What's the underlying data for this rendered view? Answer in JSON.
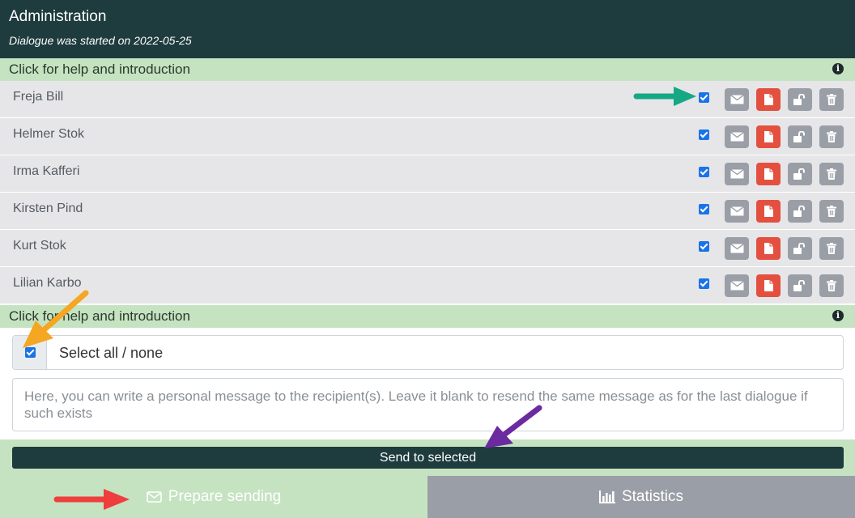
{
  "header": {
    "title": "Administration",
    "subtitle": "Dialogue was started on 2022-05-25"
  },
  "help": {
    "label": "Click for help and introduction",
    "icon": "info-icon"
  },
  "participants": [
    {
      "name": "Freja Bill",
      "selected": true
    },
    {
      "name": "Helmer Stok",
      "selected": true
    },
    {
      "name": "Irma Kafferi",
      "selected": true
    },
    {
      "name": "Kirsten Pind",
      "selected": true
    },
    {
      "name": "Kurt Stok",
      "selected": true
    },
    {
      "name": "Lilian Karbo",
      "selected": true
    }
  ],
  "row_actions": [
    "envelope-icon",
    "file-icon",
    "unlock-icon",
    "trash-icon"
  ],
  "select_all": {
    "label": "Select all / none",
    "checked": true
  },
  "message": {
    "placeholder": "Here, you can write a personal message to the recipient(s). Leave it blank to resend the same message as for the last dialogue if such exists",
    "value": ""
  },
  "send_button": "Send to selected",
  "tabs": [
    {
      "label": "Prepare sending",
      "icon": "envelope-icon",
      "active": true
    },
    {
      "label": "Statistics",
      "icon": "bar-chart-icon",
      "active": false
    }
  ],
  "colors": {
    "header_bg": "#1e3b3d",
    "help_bg": "#c5e3c1",
    "row_bg": "#e6e6e9",
    "button_gray": "#9a9ea6",
    "button_red": "#e4503f",
    "checkbox_blue": "#1a73e8",
    "annotation_arrows": [
      "#16a884",
      "#f5a623",
      "#6b2aa0",
      "#ee3e3e"
    ]
  }
}
